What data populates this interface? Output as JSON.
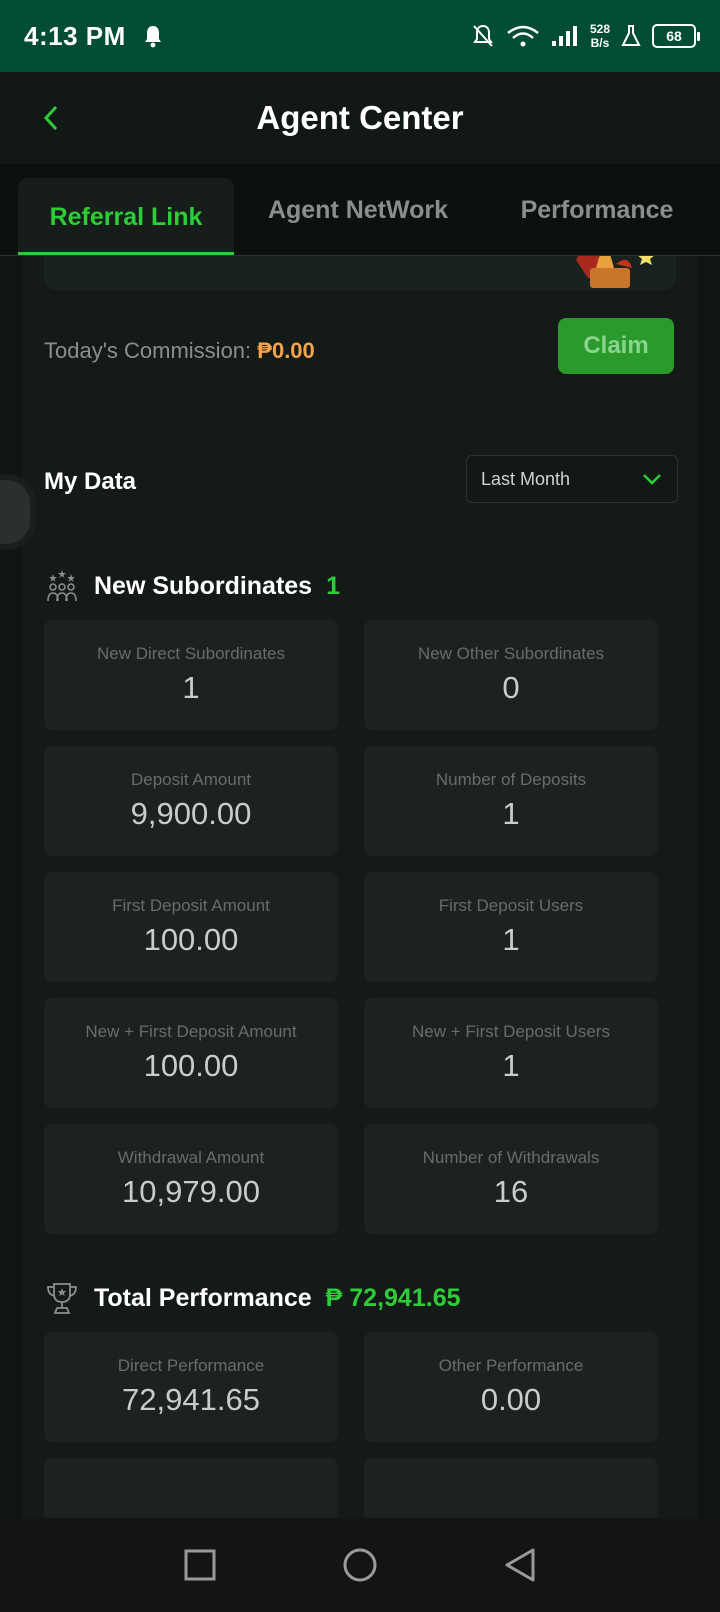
{
  "status_bar": {
    "time": "4:13 PM",
    "net_speed_value": "528",
    "net_speed_unit": "B/s",
    "battery": "68"
  },
  "header": {
    "title": "Agent Center",
    "back_icon": "chevron-left-icon"
  },
  "tabs": [
    {
      "label": "Referral Link",
      "active": true
    },
    {
      "label": "Agent NetWork",
      "active": false
    },
    {
      "label": "Performance",
      "active": false
    }
  ],
  "commission": {
    "label": "Today's Commission:",
    "amount": "₱0.00",
    "claim_label": "Claim"
  },
  "my_data": {
    "title": "My Data",
    "period": "Last Month",
    "new_subordinates": {
      "title": "New Subordinates",
      "count": "1",
      "stats": [
        {
          "label": "New Direct Subordinates",
          "value": "1"
        },
        {
          "label": "New Other Subordinates",
          "value": "0"
        },
        {
          "label": "Deposit Amount",
          "value": "9,900.00"
        },
        {
          "label": "Number of Deposits",
          "value": "1"
        },
        {
          "label": "First Deposit Amount",
          "value": "100.00"
        },
        {
          "label": "First Deposit Users",
          "value": "1"
        },
        {
          "label": "New + First Deposit Amount",
          "value": "100.00"
        },
        {
          "label": "New + First Deposit Users",
          "value": "1"
        },
        {
          "label": "Withdrawal Amount",
          "value": "10,979.00"
        },
        {
          "label": "Number of Withdrawals",
          "value": "16"
        }
      ]
    },
    "total_performance": {
      "title": "Total Performance",
      "amount": "₱ 72,941.65",
      "stats": [
        {
          "label": "Direct Performance",
          "value": "72,941.65"
        },
        {
          "label": "Other Performance",
          "value": "0.00"
        }
      ]
    }
  },
  "colors": {
    "accent_green": "#2ecc37",
    "status_bar": "#034d36",
    "commission_amount": "#f4a44a",
    "claim_button": "#2a9a2d"
  }
}
